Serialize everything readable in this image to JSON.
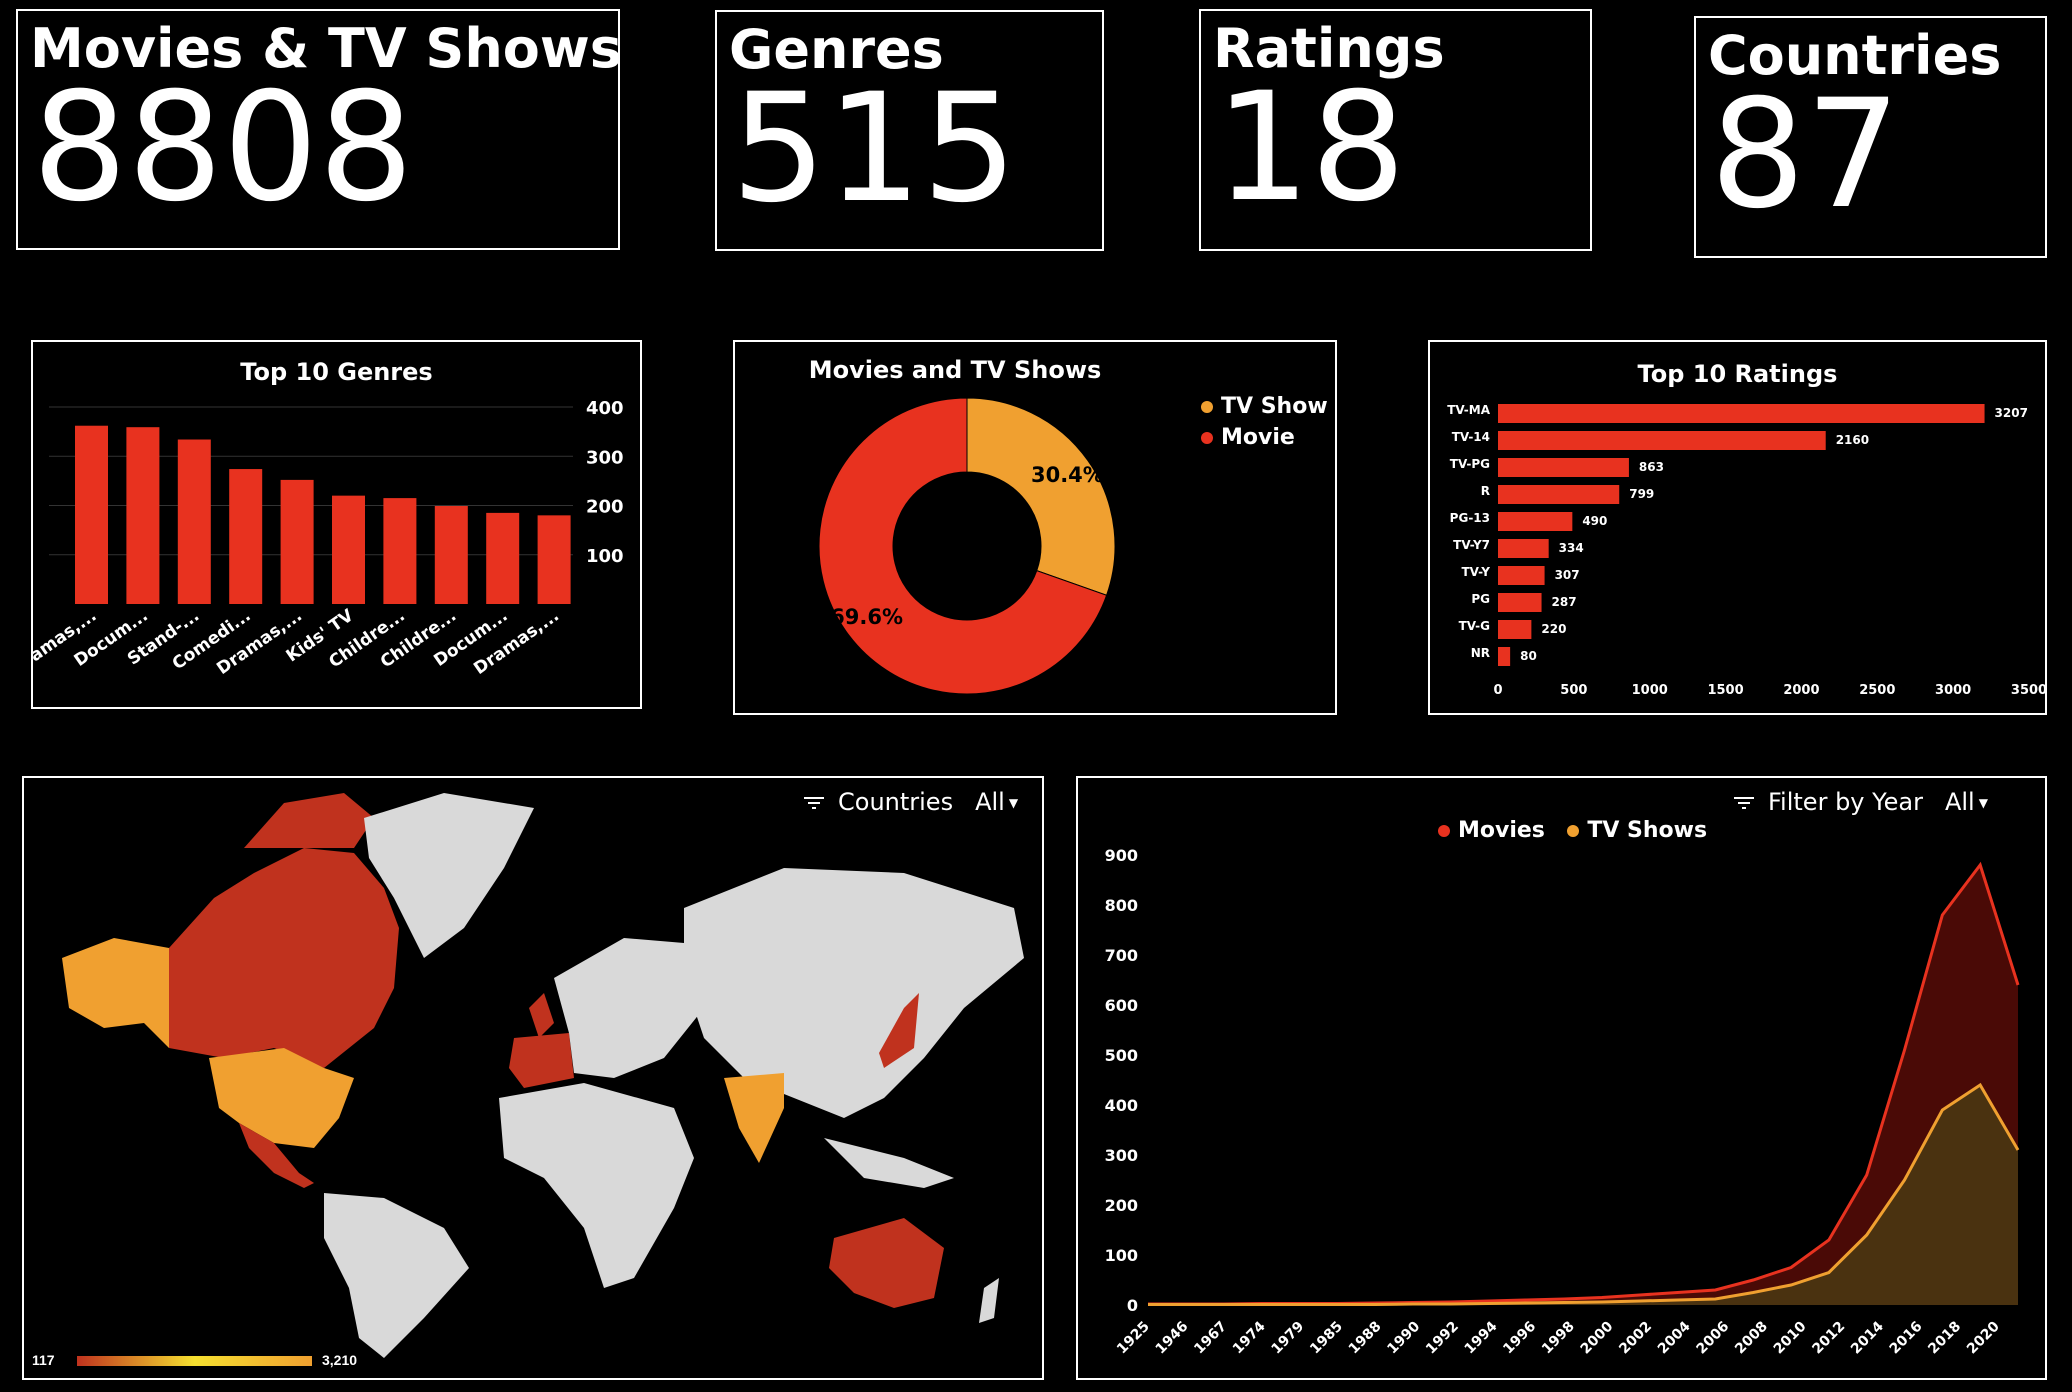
{
  "colors": {
    "movie": "#e8321f",
    "tv": "#f0a030",
    "land": "#d9d9d9",
    "bg": "#000000"
  },
  "kpis": [
    {
      "label": "Movies & TV Shows",
      "value": "8808"
    },
    {
      "label": "Genres",
      "value": "515"
    },
    {
      "label": "Ratings",
      "value": "18"
    },
    {
      "label": "Countries",
      "value": "87"
    }
  ],
  "genres_chart": {
    "title": "Top 10 Genres",
    "chart_data": {
      "type": "bar",
      "categories": [
        "Dramas,...",
        "Docum...",
        "Stand-...",
        "Comedi...",
        "Dramas,...",
        "Kids' TV",
        "Childre...",
        "Childre...",
        "Docum...",
        "Dramas,..."
      ],
      "values": [
        362,
        359,
        334,
        274,
        252,
        220,
        215,
        199,
        185,
        180
      ],
      "yticks": [
        100,
        200,
        300,
        400
      ],
      "ylim": [
        0,
        400
      ]
    }
  },
  "donut_chart": {
    "title": "Movies and TV Shows",
    "chart_data": {
      "type": "pie",
      "labels": [
        "TV Show",
        "Movie"
      ],
      "values": [
        30.4,
        69.6
      ],
      "value_labels": [
        "30.4%",
        "69.6%"
      ]
    }
  },
  "ratings_chart": {
    "title": "Top 10 Ratings",
    "chart_data": {
      "type": "bar",
      "orientation": "horizontal",
      "categories": [
        "TV-MA",
        "TV-14",
        "TV-PG",
        "R",
        "PG-13",
        "TV-Y7",
        "TV-Y",
        "PG",
        "TV-G",
        "NR"
      ],
      "values": [
        3207,
        2160,
        863,
        799,
        490,
        334,
        307,
        287,
        220,
        80
      ],
      "xticks": [
        "0",
        "500",
        "1000",
        "1500",
        "2000",
        "2500",
        "3000",
        "3500"
      ],
      "xlim": [
        0,
        3500
      ]
    }
  },
  "map_panel": {
    "filter_label": "Countries",
    "filter_value": "All",
    "scale_min": "117",
    "scale_max": "3,210"
  },
  "timeline_chart": {
    "filter_label": "Filter by Year",
    "filter_value": "All",
    "chart_data": {
      "type": "area",
      "x_labels": [
        "1925",
        "1946",
        "1967",
        "1974",
        "1979",
        "1985",
        "1988",
        "1990",
        "1992",
        "1994",
        "1996",
        "1998",
        "2000",
        "2002",
        "2004",
        "2006",
        "2008",
        "2010",
        "2012",
        "2014",
        "2016",
        "2018",
        "2020"
      ],
      "yticks": [
        0,
        100,
        200,
        300,
        400,
        500,
        600,
        700,
        800,
        900
      ],
      "ylim": [
        0,
        900
      ],
      "series": [
        {
          "name": "Movies",
          "values": [
            2,
            2,
            2,
            3,
            3,
            3,
            4,
            5,
            6,
            8,
            10,
            12,
            15,
            20,
            25,
            30,
            50,
            75,
            130,
            260,
            510,
            780,
            880,
            640
          ]
        },
        {
          "name": "TV Shows",
          "values": [
            1,
            1,
            1,
            1,
            1,
            1,
            1,
            2,
            2,
            3,
            4,
            5,
            6,
            8,
            10,
            12,
            25,
            40,
            65,
            140,
            250,
            390,
            440,
            310
          ]
        }
      ]
    }
  }
}
